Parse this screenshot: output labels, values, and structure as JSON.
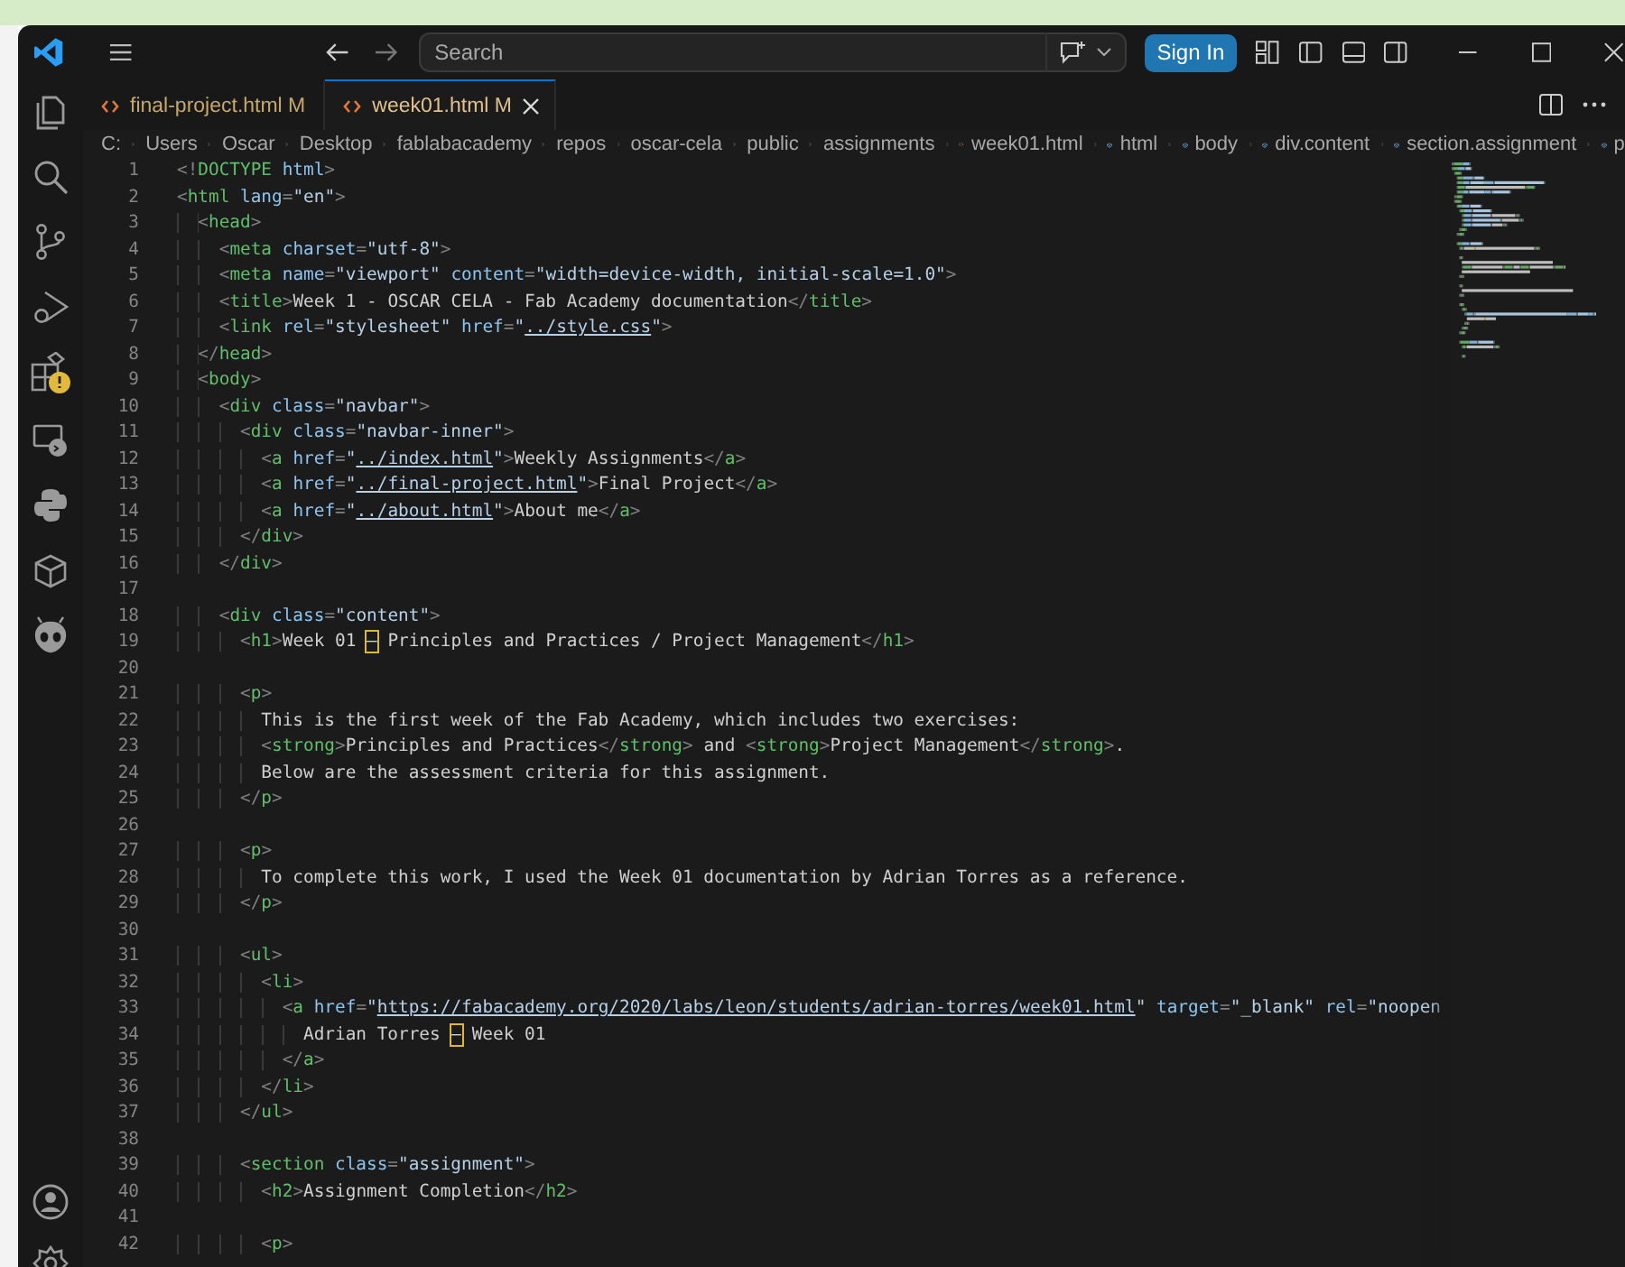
{
  "title_bar": {
    "search": {
      "placeholder": "Search"
    },
    "sign_in": "Sign In"
  },
  "tabs": [
    {
      "label": "final-project.html",
      "status": "M",
      "selected": false
    },
    {
      "label": "week01.html",
      "status": "M",
      "selected": true
    }
  ],
  "breadcrumb": [
    {
      "label": "C:",
      "kind": "folder"
    },
    {
      "label": "Users",
      "kind": "folder"
    },
    {
      "label": "Oscar",
      "kind": "folder"
    },
    {
      "label": "Desktop",
      "kind": "folder"
    },
    {
      "label": "fablabacademy",
      "kind": "folder"
    },
    {
      "label": "repos",
      "kind": "folder"
    },
    {
      "label": "oscar-cela",
      "kind": "folder"
    },
    {
      "label": "public",
      "kind": "folder"
    },
    {
      "label": "assignments",
      "kind": "folder"
    },
    {
      "label": "week01.html",
      "kind": "file"
    },
    {
      "label": "html",
      "kind": "symbol"
    },
    {
      "label": "body",
      "kind": "symbol"
    },
    {
      "label": "div.content",
      "kind": "symbol"
    },
    {
      "label": "section.assignment",
      "kind": "symbol"
    },
    {
      "label": "p",
      "kind": "symbol"
    }
  ],
  "editor": {
    "lines": [
      {
        "number": "1",
        "tokens": [
          {
            "kind": "p",
            "text": "<!"
          },
          {
            "kind": "tag",
            "text": "DOCTYPE"
          },
          {
            "kind": "attr",
            "text": " html"
          },
          {
            "kind": "p",
            "text": ">"
          }
        ]
      },
      {
        "number": "2",
        "tokens": [
          {
            "kind": "p",
            "text": "<"
          },
          {
            "kind": "tag",
            "text": "html"
          },
          {
            "kind": "attr",
            "text": " lang"
          },
          {
            "kind": "p",
            "text": "="
          },
          {
            "kind": "str",
            "text": "\"en\""
          },
          {
            "kind": "p",
            "text": ">"
          }
        ]
      },
      {
        "number": "3",
        "tokens": [
          {
            "kind": "p",
            "text": "  <"
          },
          {
            "kind": "tag",
            "text": "head"
          },
          {
            "kind": "p",
            "text": ">"
          }
        ]
      },
      {
        "number": "4",
        "tokens": [
          {
            "kind": "p",
            "text": "    <"
          },
          {
            "kind": "tag",
            "text": "meta"
          },
          {
            "kind": "attr",
            "text": " charset"
          },
          {
            "kind": "p",
            "text": "="
          },
          {
            "kind": "str",
            "text": "\"utf-8\""
          },
          {
            "kind": "p",
            "text": ">"
          }
        ]
      },
      {
        "number": "5",
        "tokens": [
          {
            "kind": "p",
            "text": "    <"
          },
          {
            "kind": "tag",
            "text": "meta"
          },
          {
            "kind": "attr",
            "text": " name"
          },
          {
            "kind": "p",
            "text": "="
          },
          {
            "kind": "str",
            "text": "\"viewport\""
          },
          {
            "kind": "attr",
            "text": " content"
          },
          {
            "kind": "p",
            "text": "="
          },
          {
            "kind": "str",
            "text": "\"width=device-width, initial-scale=1.0\""
          },
          {
            "kind": "p",
            "text": ">"
          }
        ]
      },
      {
        "number": "6",
        "tokens": [
          {
            "kind": "p",
            "text": "    <"
          },
          {
            "kind": "tag",
            "text": "title"
          },
          {
            "kind": "p",
            "text": ">"
          },
          {
            "kind": "txt",
            "text": "Week 1 - OSCAR CELA - Fab Academy documentation"
          },
          {
            "kind": "p",
            "text": "</"
          },
          {
            "kind": "tag",
            "text": "title"
          },
          {
            "kind": "p",
            "text": ">"
          }
        ]
      },
      {
        "number": "7",
        "tokens": [
          {
            "kind": "p",
            "text": "    <"
          },
          {
            "kind": "tag",
            "text": "link"
          },
          {
            "kind": "attr",
            "text": " rel"
          },
          {
            "kind": "p",
            "text": "="
          },
          {
            "kind": "str",
            "text": "\"stylesheet\""
          },
          {
            "kind": "attr",
            "text": " href"
          },
          {
            "kind": "p",
            "text": "="
          },
          {
            "kind": "str",
            "text": "\""
          },
          {
            "kind": "link",
            "text": "../style.css"
          },
          {
            "kind": "str",
            "text": "\""
          },
          {
            "kind": "p",
            "text": ">"
          }
        ]
      },
      {
        "number": "8",
        "tokens": [
          {
            "kind": "p",
            "text": "  </"
          },
          {
            "kind": "tag",
            "text": "head"
          },
          {
            "kind": "p",
            "text": ">"
          }
        ]
      },
      {
        "number": "9",
        "tokens": [
          {
            "kind": "p",
            "text": "  <"
          },
          {
            "kind": "tag",
            "text": "body"
          },
          {
            "kind": "p",
            "text": ">"
          }
        ]
      },
      {
        "number": "10",
        "tokens": [
          {
            "kind": "p",
            "text": "    <"
          },
          {
            "kind": "tag",
            "text": "div"
          },
          {
            "kind": "attr",
            "text": " class"
          },
          {
            "kind": "p",
            "text": "="
          },
          {
            "kind": "str",
            "text": "\"navbar\""
          },
          {
            "kind": "p",
            "text": ">"
          }
        ]
      },
      {
        "number": "11",
        "tokens": [
          {
            "kind": "p",
            "text": "      <"
          },
          {
            "kind": "tag",
            "text": "div"
          },
          {
            "kind": "attr",
            "text": " class"
          },
          {
            "kind": "p",
            "text": "="
          },
          {
            "kind": "str",
            "text": "\"navbar-inner\""
          },
          {
            "kind": "p",
            "text": ">"
          }
        ]
      },
      {
        "number": "12",
        "tokens": [
          {
            "kind": "p",
            "text": "        <"
          },
          {
            "kind": "tag",
            "text": "a"
          },
          {
            "kind": "attr",
            "text": " href"
          },
          {
            "kind": "p",
            "text": "="
          },
          {
            "kind": "str",
            "text": "\""
          },
          {
            "kind": "link",
            "text": "../index.html"
          },
          {
            "kind": "str",
            "text": "\""
          },
          {
            "kind": "p",
            "text": ">"
          },
          {
            "kind": "txt",
            "text": "Weekly Assignments"
          },
          {
            "kind": "p",
            "text": "</"
          },
          {
            "kind": "tag",
            "text": "a"
          },
          {
            "kind": "p",
            "text": ">"
          }
        ]
      },
      {
        "number": "13",
        "tokens": [
          {
            "kind": "p",
            "text": "        <"
          },
          {
            "kind": "tag",
            "text": "a"
          },
          {
            "kind": "attr",
            "text": " href"
          },
          {
            "kind": "p",
            "text": "="
          },
          {
            "kind": "str",
            "text": "\""
          },
          {
            "kind": "link",
            "text": "../final-project.html"
          },
          {
            "kind": "str",
            "text": "\""
          },
          {
            "kind": "p",
            "text": ">"
          },
          {
            "kind": "txt",
            "text": "Final Project"
          },
          {
            "kind": "p",
            "text": "</"
          },
          {
            "kind": "tag",
            "text": "a"
          },
          {
            "kind": "p",
            "text": ">"
          }
        ]
      },
      {
        "number": "14",
        "tokens": [
          {
            "kind": "p",
            "text": "        <"
          },
          {
            "kind": "tag",
            "text": "a"
          },
          {
            "kind": "attr",
            "text": " href"
          },
          {
            "kind": "p",
            "text": "="
          },
          {
            "kind": "str",
            "text": "\""
          },
          {
            "kind": "link",
            "text": "../about.html"
          },
          {
            "kind": "str",
            "text": "\""
          },
          {
            "kind": "p",
            "text": ">"
          },
          {
            "kind": "txt",
            "text": "About me"
          },
          {
            "kind": "p",
            "text": "</"
          },
          {
            "kind": "tag",
            "text": "a"
          },
          {
            "kind": "p",
            "text": ">"
          }
        ]
      },
      {
        "number": "15",
        "tokens": [
          {
            "kind": "p",
            "text": "      </"
          },
          {
            "kind": "tag",
            "text": "div"
          },
          {
            "kind": "p",
            "text": ">"
          }
        ]
      },
      {
        "number": "16",
        "tokens": [
          {
            "kind": "p",
            "text": "    </"
          },
          {
            "kind": "tag",
            "text": "div"
          },
          {
            "kind": "p",
            "text": ">"
          }
        ]
      },
      {
        "number": "17"
      },
      {
        "number": "18",
        "tokens": [
          {
            "kind": "p",
            "text": "    <"
          },
          {
            "kind": "tag",
            "text": "div"
          },
          {
            "kind": "attr",
            "text": " class"
          },
          {
            "kind": "p",
            "text": "="
          },
          {
            "kind": "str",
            "text": "\"content\""
          },
          {
            "kind": "p",
            "text": ">"
          }
        ]
      },
      {
        "number": "19",
        "tokens": [
          {
            "kind": "p",
            "text": "      <"
          },
          {
            "kind": "tag",
            "text": "h1"
          },
          {
            "kind": "p",
            "text": ">"
          },
          {
            "kind": "txt",
            "text": "Week 01 "
          },
          {
            "kind": "mark",
            "text": "–"
          },
          {
            "kind": "txt",
            "text": " Principles and Practices / Project Management"
          },
          {
            "kind": "p",
            "text": "</"
          },
          {
            "kind": "tag",
            "text": "h1"
          },
          {
            "kind": "p",
            "text": ">"
          }
        ]
      },
      {
        "number": "20"
      },
      {
        "number": "21",
        "tokens": [
          {
            "kind": "p",
            "text": "      <"
          },
          {
            "kind": "tag",
            "text": "p"
          },
          {
            "kind": "p",
            "text": ">"
          }
        ]
      },
      {
        "number": "22",
        "tokens": [
          {
            "kind": "txt",
            "text": "        This is the first week of the Fab Academy, which includes two exercises:"
          }
        ]
      },
      {
        "number": "23",
        "tokens": [
          {
            "kind": "p",
            "text": "        <"
          },
          {
            "kind": "tag",
            "text": "strong"
          },
          {
            "kind": "p",
            "text": ">"
          },
          {
            "kind": "txt",
            "text": "Principles and Practices"
          },
          {
            "kind": "p",
            "text": "</"
          },
          {
            "kind": "tag",
            "text": "strong"
          },
          {
            "kind": "p",
            "text": ">"
          },
          {
            "kind": "txt",
            "text": " and "
          },
          {
            "kind": "p",
            "text": "<"
          },
          {
            "kind": "tag",
            "text": "strong"
          },
          {
            "kind": "p",
            "text": ">"
          },
          {
            "kind": "txt",
            "text": "Project Management"
          },
          {
            "kind": "p",
            "text": "</"
          },
          {
            "kind": "tag",
            "text": "strong"
          },
          {
            "kind": "p",
            "text": ">"
          },
          {
            "kind": "txt",
            "text": "."
          }
        ]
      },
      {
        "number": "24",
        "tokens": [
          {
            "kind": "txt",
            "text": "        Below are the assessment criteria for this assignment."
          }
        ]
      },
      {
        "number": "25",
        "tokens": [
          {
            "kind": "p",
            "text": "      </"
          },
          {
            "kind": "tag",
            "text": "p"
          },
          {
            "kind": "p",
            "text": ">"
          }
        ]
      },
      {
        "number": "26"
      },
      {
        "number": "27",
        "tokens": [
          {
            "kind": "p",
            "text": "      <"
          },
          {
            "kind": "tag",
            "text": "p"
          },
          {
            "kind": "p",
            "text": ">"
          }
        ]
      },
      {
        "number": "28",
        "tokens": [
          {
            "kind": "txt",
            "text": "        To complete this work, I used the Week 01 documentation by Adrian Torres as a reference."
          }
        ]
      },
      {
        "number": "29",
        "tokens": [
          {
            "kind": "p",
            "text": "      </"
          },
          {
            "kind": "tag",
            "text": "p"
          },
          {
            "kind": "p",
            "text": ">"
          }
        ]
      },
      {
        "number": "30"
      },
      {
        "number": "31",
        "tokens": [
          {
            "kind": "p",
            "text": "      <"
          },
          {
            "kind": "tag",
            "text": "ul"
          },
          {
            "kind": "p",
            "text": ">"
          }
        ]
      },
      {
        "number": "32",
        "tokens": [
          {
            "kind": "p",
            "text": "        <"
          },
          {
            "kind": "tag",
            "text": "li"
          },
          {
            "kind": "p",
            "text": ">"
          }
        ]
      },
      {
        "number": "33",
        "tokens": [
          {
            "kind": "p",
            "text": "          <"
          },
          {
            "kind": "tag",
            "text": "a"
          },
          {
            "kind": "attr",
            "text": " href"
          },
          {
            "kind": "p",
            "text": "="
          },
          {
            "kind": "str",
            "text": "\""
          },
          {
            "kind": "link",
            "text": "https://fabacademy.org/2020/labs/leon/students/adrian-torres/week01.html"
          },
          {
            "kind": "str",
            "text": "\""
          },
          {
            "kind": "attr",
            "text": " target"
          },
          {
            "kind": "p",
            "text": "="
          },
          {
            "kind": "str",
            "text": "\"_blank\""
          },
          {
            "kind": "attr",
            "text": " rel"
          },
          {
            "kind": "p",
            "text": "="
          },
          {
            "kind": "str",
            "text": "\"noopen"
          }
        ]
      },
      {
        "number": "34",
        "tokens": [
          {
            "kind": "txt",
            "text": "            Adrian Torres "
          },
          {
            "kind": "mark",
            "text": "–"
          },
          {
            "kind": "txt",
            "text": " Week 01"
          }
        ]
      },
      {
        "number": "35",
        "tokens": [
          {
            "kind": "p",
            "text": "          </"
          },
          {
            "kind": "tag",
            "text": "a"
          },
          {
            "kind": "p",
            "text": ">"
          }
        ]
      },
      {
        "number": "36",
        "tokens": [
          {
            "kind": "p",
            "text": "        </"
          },
          {
            "kind": "tag",
            "text": "li"
          },
          {
            "kind": "p",
            "text": ">"
          }
        ]
      },
      {
        "number": "37",
        "tokens": [
          {
            "kind": "p",
            "text": "      </"
          },
          {
            "kind": "tag",
            "text": "ul"
          },
          {
            "kind": "p",
            "text": ">"
          }
        ]
      },
      {
        "number": "38"
      },
      {
        "number": "39",
        "tokens": [
          {
            "kind": "p",
            "text": "      <"
          },
          {
            "kind": "tag",
            "text": "section"
          },
          {
            "kind": "attr",
            "text": " class"
          },
          {
            "kind": "p",
            "text": "="
          },
          {
            "kind": "str",
            "text": "\"assignment\""
          },
          {
            "kind": "p",
            "text": ">"
          }
        ]
      },
      {
        "number": "40",
        "tokens": [
          {
            "kind": "p",
            "text": "        <"
          },
          {
            "kind": "tag",
            "text": "h2"
          },
          {
            "kind": "p",
            "text": ">"
          },
          {
            "kind": "txt",
            "text": "Assignment Completion"
          },
          {
            "kind": "p",
            "text": "</"
          },
          {
            "kind": "tag",
            "text": "h2"
          },
          {
            "kind": "p",
            "text": ">"
          }
        ]
      },
      {
        "number": "41"
      },
      {
        "number": "42",
        "tokens": [
          {
            "kind": "p",
            "text": "        <"
          },
          {
            "kind": "tag",
            "text": "p"
          },
          {
            "kind": "p",
            "text": ">"
          }
        ]
      }
    ]
  }
}
